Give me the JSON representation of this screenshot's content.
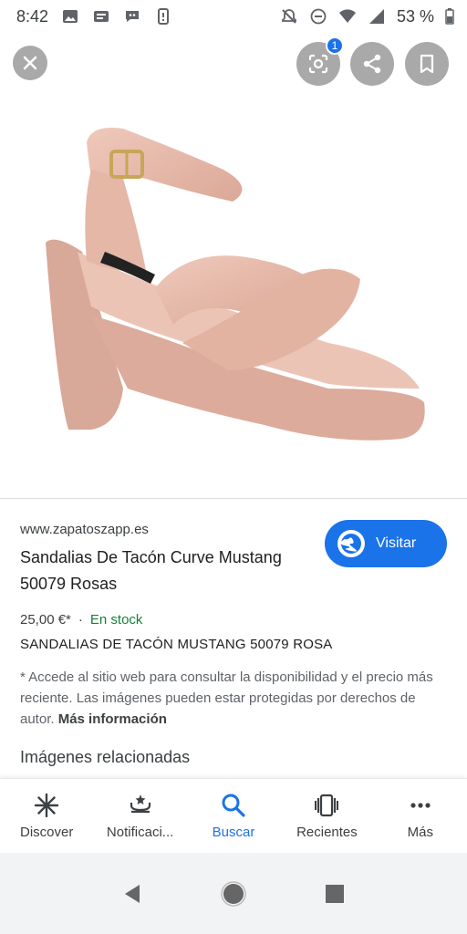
{
  "status_bar": {
    "time": "8:42",
    "battery_text": "53 %"
  },
  "toolbar": {
    "lens_badge": "1"
  },
  "result": {
    "site": "www.zapatoszapp.es",
    "title": "Sandalias De Tacón Curve Mustang 50079 Rosas",
    "visit_label": "Visitar",
    "price": "25,00 €*",
    "separator": "·",
    "stock": "En stock",
    "description": "SANDALIAS DE TACÓN MUSTANG 50079 ROSA",
    "disclaimer": "* Accede al sitio web para consultar la disponibilidad y el precio más reciente. Las imágenes pueden estar protegidas por derechos de autor.",
    "more_info": "Más información",
    "related_heading": "Imágenes relacionadas"
  },
  "bottom_nav": {
    "items": [
      {
        "label": "Discover",
        "icon": "asterisk-icon"
      },
      {
        "label": "Notificaci...",
        "icon": "bell-icon"
      },
      {
        "label": "Buscar",
        "icon": "search-icon"
      },
      {
        "label": "Recientes",
        "icon": "recents-icon"
      },
      {
        "label": "Más",
        "icon": "more-icon"
      }
    ]
  },
  "colors": {
    "accent": "#1a73e8",
    "stock": "#188038",
    "shoe": "#e6b8a8"
  }
}
